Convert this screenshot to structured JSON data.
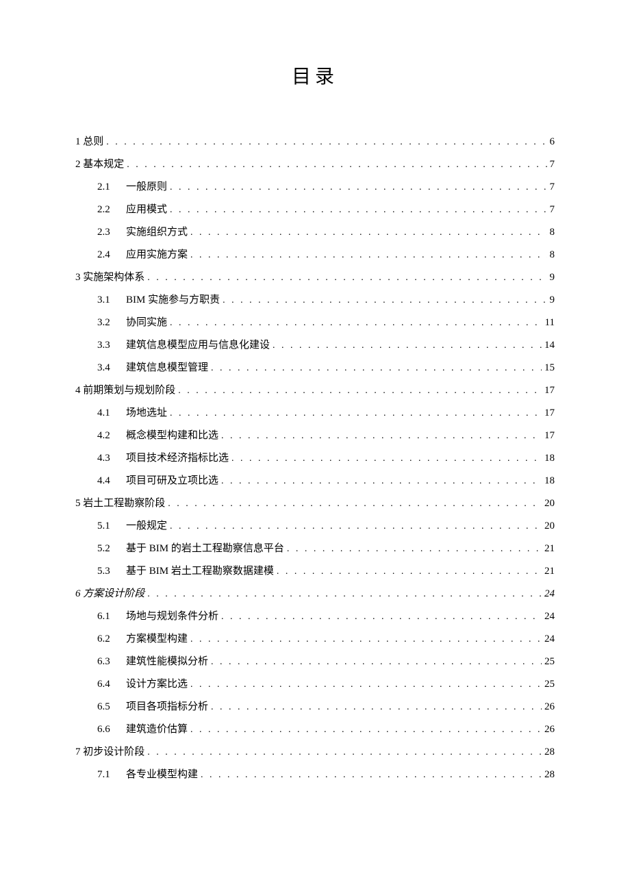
{
  "title": "目录",
  "entries": [
    {
      "level": 1,
      "num": "1",
      "label": "总则",
      "page": "6"
    },
    {
      "level": 1,
      "num": "2",
      "label": "基本规定",
      "page": "7"
    },
    {
      "level": 2,
      "num": "2.1",
      "label": "一般原则",
      "page": "7"
    },
    {
      "level": 2,
      "num": "2.2",
      "label": "应用模式",
      "page": "7"
    },
    {
      "level": 2,
      "num": "2.3",
      "label": "实施组织方式",
      "page": "8"
    },
    {
      "level": 2,
      "num": "2.4",
      "label": "应用实施方案",
      "page": "8"
    },
    {
      "level": 1,
      "num": "3",
      "label": "实施架构体系",
      "page": "9"
    },
    {
      "level": 2,
      "num": "3.1",
      "label": "BIM 实施参与方职责",
      "page": "9"
    },
    {
      "level": 2,
      "num": "3.2",
      "label": "协同实施",
      "page": "11"
    },
    {
      "level": 2,
      "num": "3.3",
      "label": "建筑信息模型应用与信息化建设",
      "page": "14"
    },
    {
      "level": 2,
      "num": "3.4",
      "label": "建筑信息模型管理",
      "page": "15"
    },
    {
      "level": 1,
      "num": "4",
      "label": "前期策划与规划阶段",
      "page": "17"
    },
    {
      "level": 2,
      "num": "4.1",
      "label": "场地选址",
      "page": "17"
    },
    {
      "level": 2,
      "num": "4.2",
      "label": "概念模型构建和比选",
      "page": "17"
    },
    {
      "level": 2,
      "num": "4.3",
      "label": "项目技术经济指标比选",
      "page": "18"
    },
    {
      "level": 2,
      "num": "4.4",
      "label": "项目可研及立项比选",
      "page": "18"
    },
    {
      "level": 1,
      "num": "5",
      "label": "岩土工程勘察阶段",
      "page": "20"
    },
    {
      "level": 2,
      "num": "5.1",
      "label": "一般规定",
      "page": "20"
    },
    {
      "level": 2,
      "num": "5.2",
      "label": "基于 BIM 的岩土工程勘察信息平台",
      "page": "21"
    },
    {
      "level": 2,
      "num": "5.3",
      "label": "基于 BIM 岩土工程勘察数据建模",
      "page": "21"
    },
    {
      "level": 1,
      "num": "6",
      "label": "方案设计阶段",
      "page": "24",
      "italic": true
    },
    {
      "level": 2,
      "num": "6.1",
      "label": "场地与规划条件分析",
      "page": "24"
    },
    {
      "level": 2,
      "num": "6.2",
      "label": "方案模型构建",
      "page": "24"
    },
    {
      "level": 2,
      "num": "6.3",
      "label": "建筑性能模拟分析",
      "page": "25"
    },
    {
      "level": 2,
      "num": "6.4",
      "label": "设计方案比选",
      "page": "25"
    },
    {
      "level": 2,
      "num": "6.5",
      "label": "项目各项指标分析",
      "page": "26"
    },
    {
      "level": 2,
      "num": "6.6",
      "label": "建筑造价估算",
      "page": "26"
    },
    {
      "level": 1,
      "num": "7",
      "label": "初步设计阶段",
      "page": "28"
    },
    {
      "level": 2,
      "num": "7.1",
      "label": "各专业模型构建",
      "page": "28"
    }
  ]
}
